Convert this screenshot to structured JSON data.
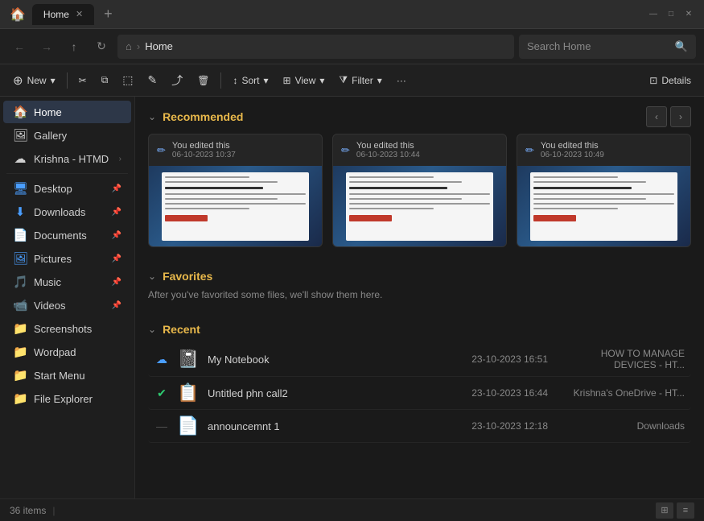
{
  "titlebar": {
    "tab_label": "Home",
    "tab_close": "✕",
    "tab_new": "+",
    "win_min": "—",
    "win_max": "□",
    "win_close": "✕"
  },
  "addressbar": {
    "nav_back": "←",
    "nav_forward": "→",
    "nav_up": "↑",
    "nav_refresh": "↻",
    "home_icon": "⌂",
    "sep": "›",
    "address": "Home",
    "search_placeholder": "Search Home",
    "search_icon": "🔍"
  },
  "toolbar": {
    "new_label": "New",
    "new_arrow": "▾",
    "cut_icon": "✂",
    "copy_icon": "⧉",
    "paste_icon": "📋",
    "rename_icon": "✎",
    "share_icon": "⤴",
    "delete_icon": "🗑",
    "sort_label": "Sort",
    "sort_arrow": "▾",
    "view_label": "View",
    "view_arrow": "▾",
    "filter_label": "Filter",
    "filter_arrow": "▾",
    "more_icon": "···",
    "details_label": "Details"
  },
  "sidebar": {
    "items": [
      {
        "id": "home",
        "icon": "🏠",
        "label": "Home",
        "active": true
      },
      {
        "id": "gallery",
        "icon": "🖼",
        "label": "Gallery",
        "active": false
      },
      {
        "id": "krishna",
        "icon": "☁",
        "label": "Krishna - HTMD",
        "active": false,
        "arrow": "›"
      }
    ],
    "pinned": [
      {
        "id": "desktop",
        "icon": "🖥",
        "label": "Desktop",
        "pinned": true
      },
      {
        "id": "downloads",
        "icon": "⬇",
        "label": "Downloads",
        "pinned": true
      },
      {
        "id": "documents",
        "icon": "📄",
        "label": "Documents",
        "pinned": true
      },
      {
        "id": "pictures",
        "icon": "🖼",
        "label": "Pictures",
        "pinned": true
      },
      {
        "id": "music",
        "icon": "🎵",
        "label": "Music",
        "pinned": true
      },
      {
        "id": "videos",
        "icon": "📹",
        "label": "Videos",
        "pinned": true
      },
      {
        "id": "screenshots",
        "icon": "📁",
        "label": "Screenshots",
        "pinned": false
      },
      {
        "id": "wordpad",
        "icon": "📁",
        "label": "Wordpad",
        "pinned": false
      },
      {
        "id": "startmenu",
        "icon": "📁",
        "label": "Start Menu",
        "pinned": false
      },
      {
        "id": "fileexplorer",
        "icon": "📁",
        "label": "File Explorer",
        "pinned": false
      }
    ]
  },
  "recommended": {
    "section_title": "Recommended",
    "chevron": "⌄",
    "nav_prev": "‹",
    "nav_next": "›",
    "cards": [
      {
        "action": "You edited this",
        "date": "06-10-2023 10:37",
        "edit_icon": "✏"
      },
      {
        "action": "You edited this",
        "date": "06-10-2023 10:44",
        "edit_icon": "✏"
      },
      {
        "action": "You edited this",
        "date": "06-10-2023 10:49",
        "edit_icon": "✏"
      }
    ]
  },
  "favorites": {
    "section_title": "Favorites",
    "chevron": "⌄",
    "empty_text": "After you've favorited some files, we'll show them here."
  },
  "recent": {
    "section_title": "Recent",
    "chevron": "⌄",
    "items": [
      {
        "type_icon": "📓",
        "status_icon": "☁",
        "name": "My Notebook",
        "date": "23-10-2023 16:51",
        "location": "HOW TO MANAGE DEVICES - HT..."
      },
      {
        "type_icon": "📋",
        "status_icon": "✅",
        "name": "Untitled phn call2",
        "date": "23-10-2023 16:44",
        "location": "Krishna's OneDrive - HT..."
      },
      {
        "type_icon": "📄",
        "status_icon": "—",
        "name": "announcemnt 1",
        "date": "23-10-2023 12:18",
        "location": "Downloads"
      }
    ]
  },
  "statusbar": {
    "items_count": "36 items",
    "sep": "|",
    "view_grid_icon": "⊞",
    "view_list_icon": "≡"
  }
}
